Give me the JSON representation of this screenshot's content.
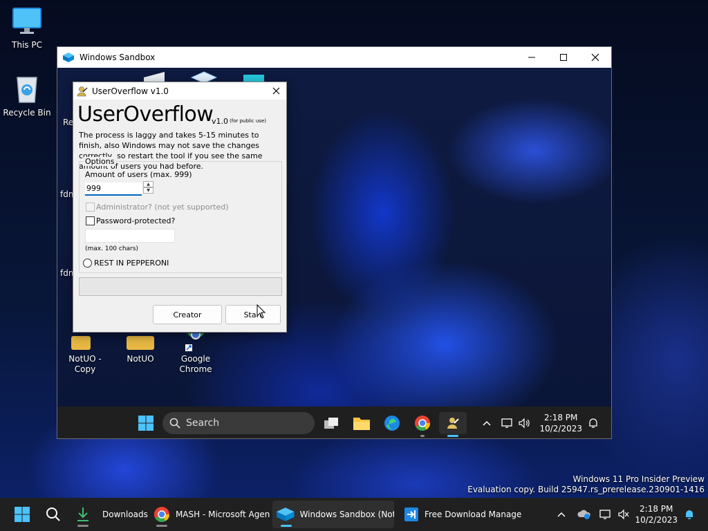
{
  "host_desktop": {
    "icons": [
      {
        "label": "This PC"
      },
      {
        "label": "Recycle Bin"
      }
    ],
    "watermark": {
      "line1": "Windows 11 Pro Insider Preview",
      "line2": "Evaluation copy. Build 25947.rs_prerelease.230901-1416"
    }
  },
  "sandbox_window": {
    "title": "Windows Sandbox",
    "desktop_icons": [
      {
        "label": "Re"
      },
      {
        "label": "fdm"
      },
      {
        "label": "fdm"
      },
      {
        "label": "NotUO - Copy"
      },
      {
        "label": "NotUO"
      },
      {
        "label": "Google Chrome"
      }
    ],
    "taskbar": {
      "search_placeholder": "Search",
      "time": "2:18 PM",
      "date": "10/2/2023"
    }
  },
  "dialog": {
    "title": "UserOverflow v1.0",
    "app_name": "UserOverflow",
    "version": "v1.0",
    "version_note": "(for public use)",
    "description": "The process is laggy and takes 5-15 minutes to finish, also Windows may not save the changes correctly, so restart the tool if you see the same amount of users you had before.",
    "options_label": "Options",
    "amount_label": "Amount of users (max. 999)",
    "amount_value": "999",
    "admin_label": "Administrator? (not yet supported)",
    "password_label": "Password-protected?",
    "password_hint": "(max. 100 chars)",
    "radio_label": "REST IN PEPPERONI",
    "progress_fraction": 0,
    "creator_button": "Creator",
    "start_button": "Start"
  },
  "host_taskbar": {
    "tasks": [
      {
        "label": "Downloads"
      },
      {
        "label": "MASH - Microsoft Agen"
      },
      {
        "label": "Windows Sandbox (Not"
      },
      {
        "label": "Free Download Manage"
      }
    ],
    "time": "2:18 PM",
    "date": "10/2/2023"
  },
  "colors": {
    "accent": "#0067c0",
    "taskbar": "#202020",
    "dialog_bg": "#f0f0f0"
  }
}
